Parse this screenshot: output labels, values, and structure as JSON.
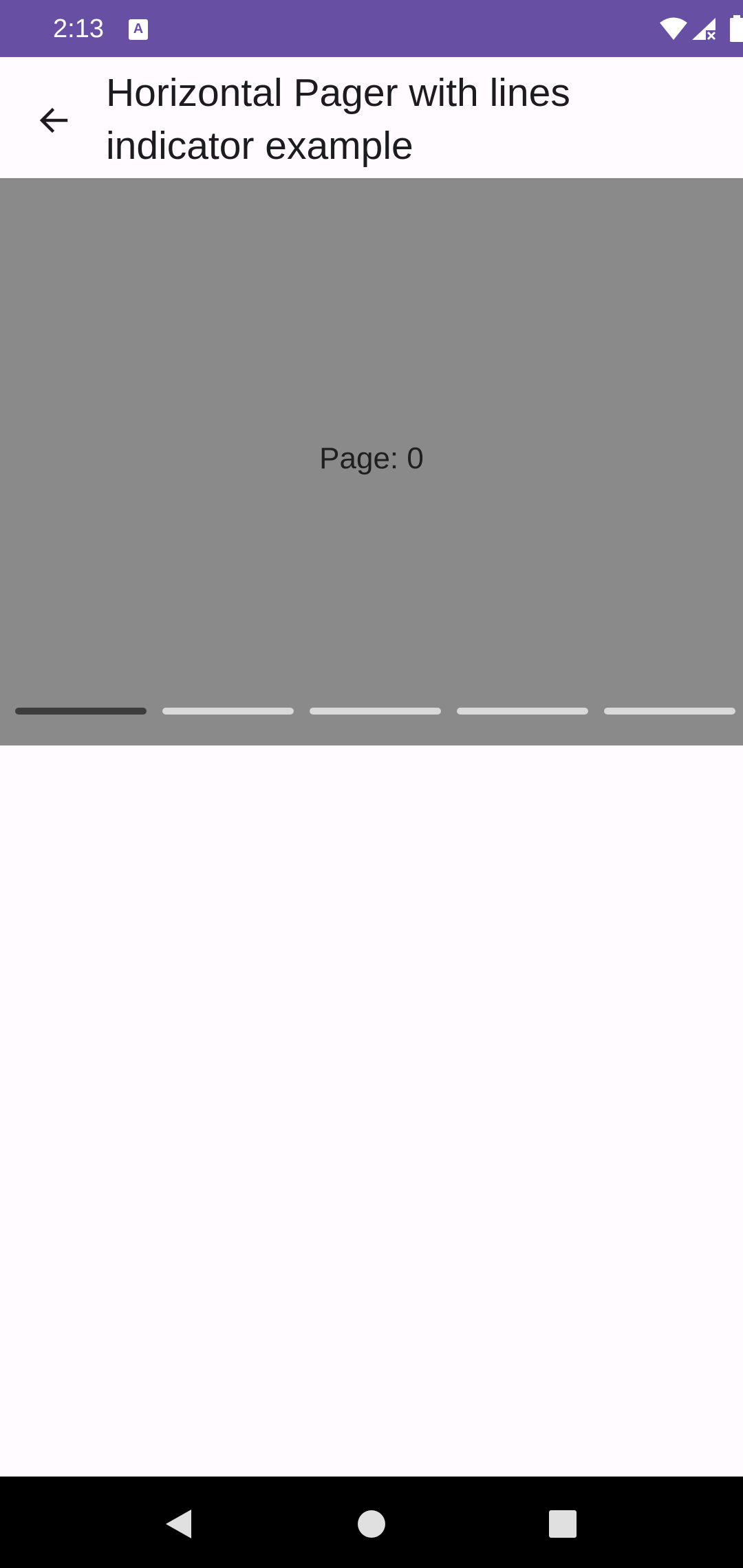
{
  "status_bar": {
    "time": "2:13",
    "app_icon_letter": "A",
    "background_color": "#6750a4",
    "icons": [
      "wifi-icon",
      "cellular-no-signal-icon",
      "battery-icon"
    ]
  },
  "top_bar": {
    "back_icon": "arrow-back-icon",
    "title": "Horizontal Pager with lines indicator example"
  },
  "pager": {
    "page_text": "Page: 0",
    "background_color": "#8a8a8a",
    "page_count": 5,
    "current_page": 0,
    "active_color": "#3d3d3d",
    "inactive_color": "#d9d9d9"
  },
  "nav_bar": {
    "buttons": [
      "back-triangle-icon",
      "home-circle-icon",
      "recents-square-icon"
    ]
  }
}
